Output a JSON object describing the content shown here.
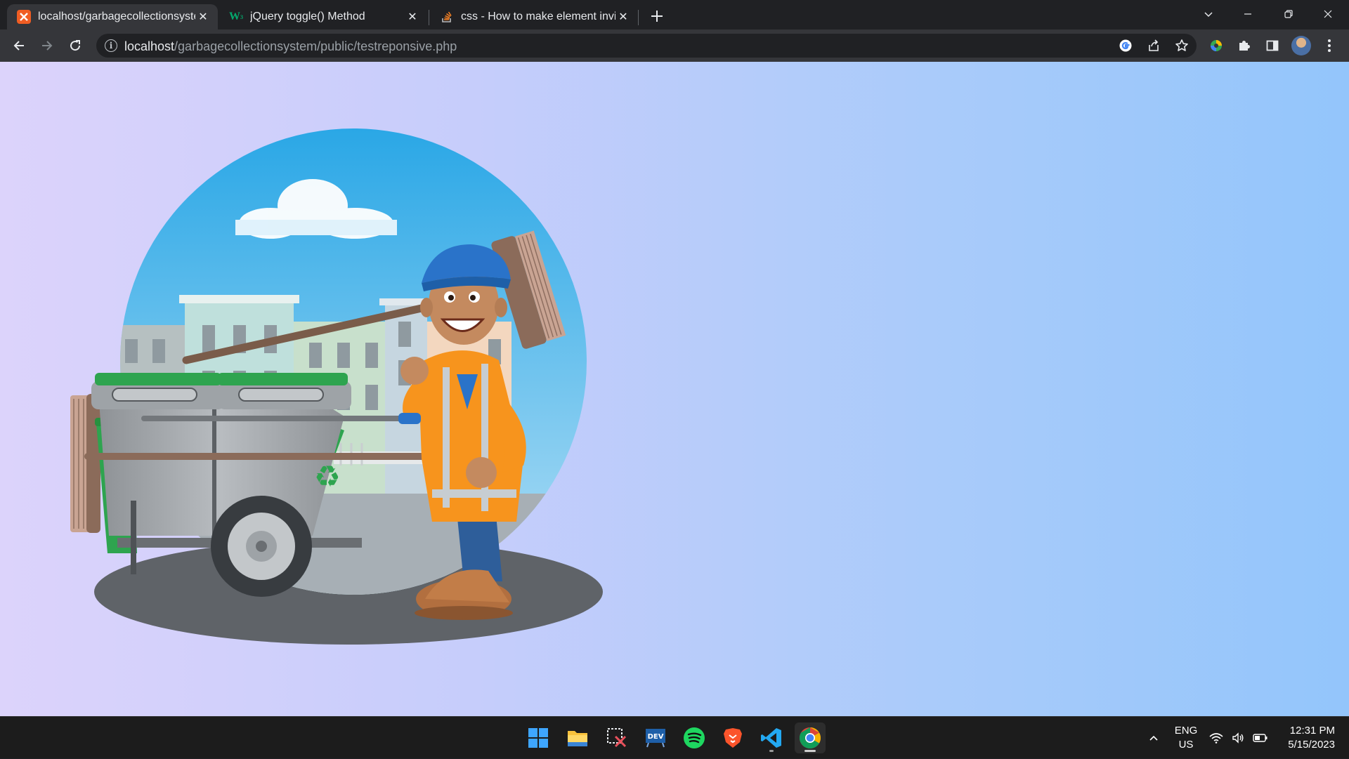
{
  "browser": {
    "tabs": [
      {
        "title": "localhost/garbagecollectionsyste",
        "favicon": "xampp-icon",
        "favicon_color": "#f05d23",
        "active": true
      },
      {
        "title": "jQuery toggle() Method",
        "favicon": "w3schools-icon",
        "favicon_color": "#04aa6d",
        "active": false
      },
      {
        "title": "css - How to make element invisi",
        "favicon": "stackoverflow-icon",
        "favicon_color": "#f48024",
        "active": false
      }
    ],
    "new_tab_icon": "plus-icon",
    "window_controls": [
      "tab-search-icon",
      "minimize-icon",
      "restore-icon",
      "close-icon"
    ],
    "url": {
      "host": "localhost",
      "path": "/garbagecollectionsystem/public/testreponsive.php"
    },
    "toolbar_icons": [
      "google-lens-icon",
      "share-icon",
      "bookmark-star-icon"
    ],
    "extension_icons": [
      "extension-colorful-icon",
      "puzzle-icon",
      "side-panel-icon",
      "profile-avatar",
      "menu-kebab-icon"
    ]
  },
  "page": {
    "illustration": "garbage-collector-with-cart-and-broom",
    "background_gradient": [
      "#dcd3fb",
      "#93c5fb"
    ]
  },
  "taskbar": {
    "apps": [
      {
        "name": "start-icon",
        "color": "#3ea6ff"
      },
      {
        "name": "file-explorer-icon",
        "color": "#f9c23c"
      },
      {
        "name": "snipping-tool-icon",
        "color": "#e8505b"
      },
      {
        "name": "dev-home-icon",
        "color": "#1e5fa8"
      },
      {
        "name": "spotify-icon",
        "color": "#1ed760"
      },
      {
        "name": "brave-icon",
        "color": "#fb542b"
      },
      {
        "name": "vscode-icon",
        "color": "#23a9f2"
      },
      {
        "name": "chrome-icon",
        "color": "#4285f4"
      }
    ],
    "language": {
      "line1": "ENG",
      "line2": "US"
    },
    "clock": {
      "time": "12:31 PM",
      "date": "5/15/2023"
    }
  }
}
